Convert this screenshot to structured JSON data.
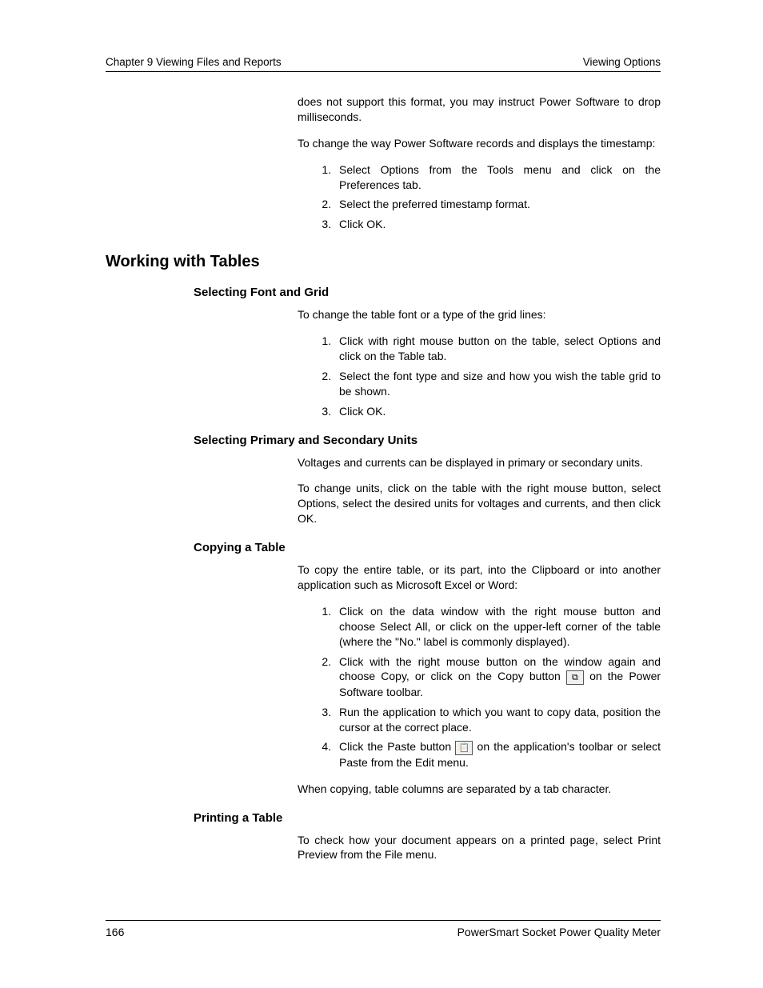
{
  "header": {
    "left": "Chapter 9 Viewing Files and Reports",
    "right": "Viewing Options"
  },
  "intro": {
    "p1": "does not support this format, you may instruct Power Software to drop milliseconds.",
    "p2": "To change the way Power Software records and displays the timestamp:",
    "steps": [
      "Select Options from the Tools menu and click on the Preferences tab.",
      "Select the preferred timestamp format.",
      "Click OK."
    ]
  },
  "h1": "Working with Tables",
  "sec1": {
    "title": "Selecting Font and Grid",
    "p1": "To change the table font or a type of the grid lines:",
    "steps": [
      "Click with right mouse button on the table, select Options and click on the Table tab.",
      "Select the font type and size and how you wish the table grid to be shown.",
      "Click OK."
    ]
  },
  "sec2": {
    "title": "Selecting Primary and Secondary Units",
    "p1": "Voltages and currents can be displayed in primary or secondary units.",
    "p2": "To change units, click on the table with the right mouse button, select Options, select the desired units for voltages and currents, and then click OK."
  },
  "sec3": {
    "title": "Copying a Table",
    "p1": "To copy the entire table, or its part, into the Clipboard or into another application such as Microsoft Excel or Word:",
    "steps": {
      "s1": "Click on the data window with the right mouse button and choose Select All, or click on the upper-left corner of the table (where the \"No.\" label is commonly displayed).",
      "s2a": "Click with the right mouse button on the window again and choose Copy, or click on the Copy button ",
      "s2b": " on the Power Software toolbar.",
      "s3": "Run the application to which you want to copy data, position the cursor at the correct place.",
      "s4a": "Click the Paste button ",
      "s4b": " on the application's toolbar or select Paste from the Edit menu."
    },
    "p2": "When copying, table columns are separated by a tab character."
  },
  "sec4": {
    "title": "Printing a Table",
    "p1": "To check how your document appears on a printed page, select Print Preview from the File menu."
  },
  "icons": {
    "copy": "⧉",
    "paste": "📋"
  },
  "footer": {
    "page": "166",
    "title": "PowerSmart Socket Power Quality Meter"
  }
}
